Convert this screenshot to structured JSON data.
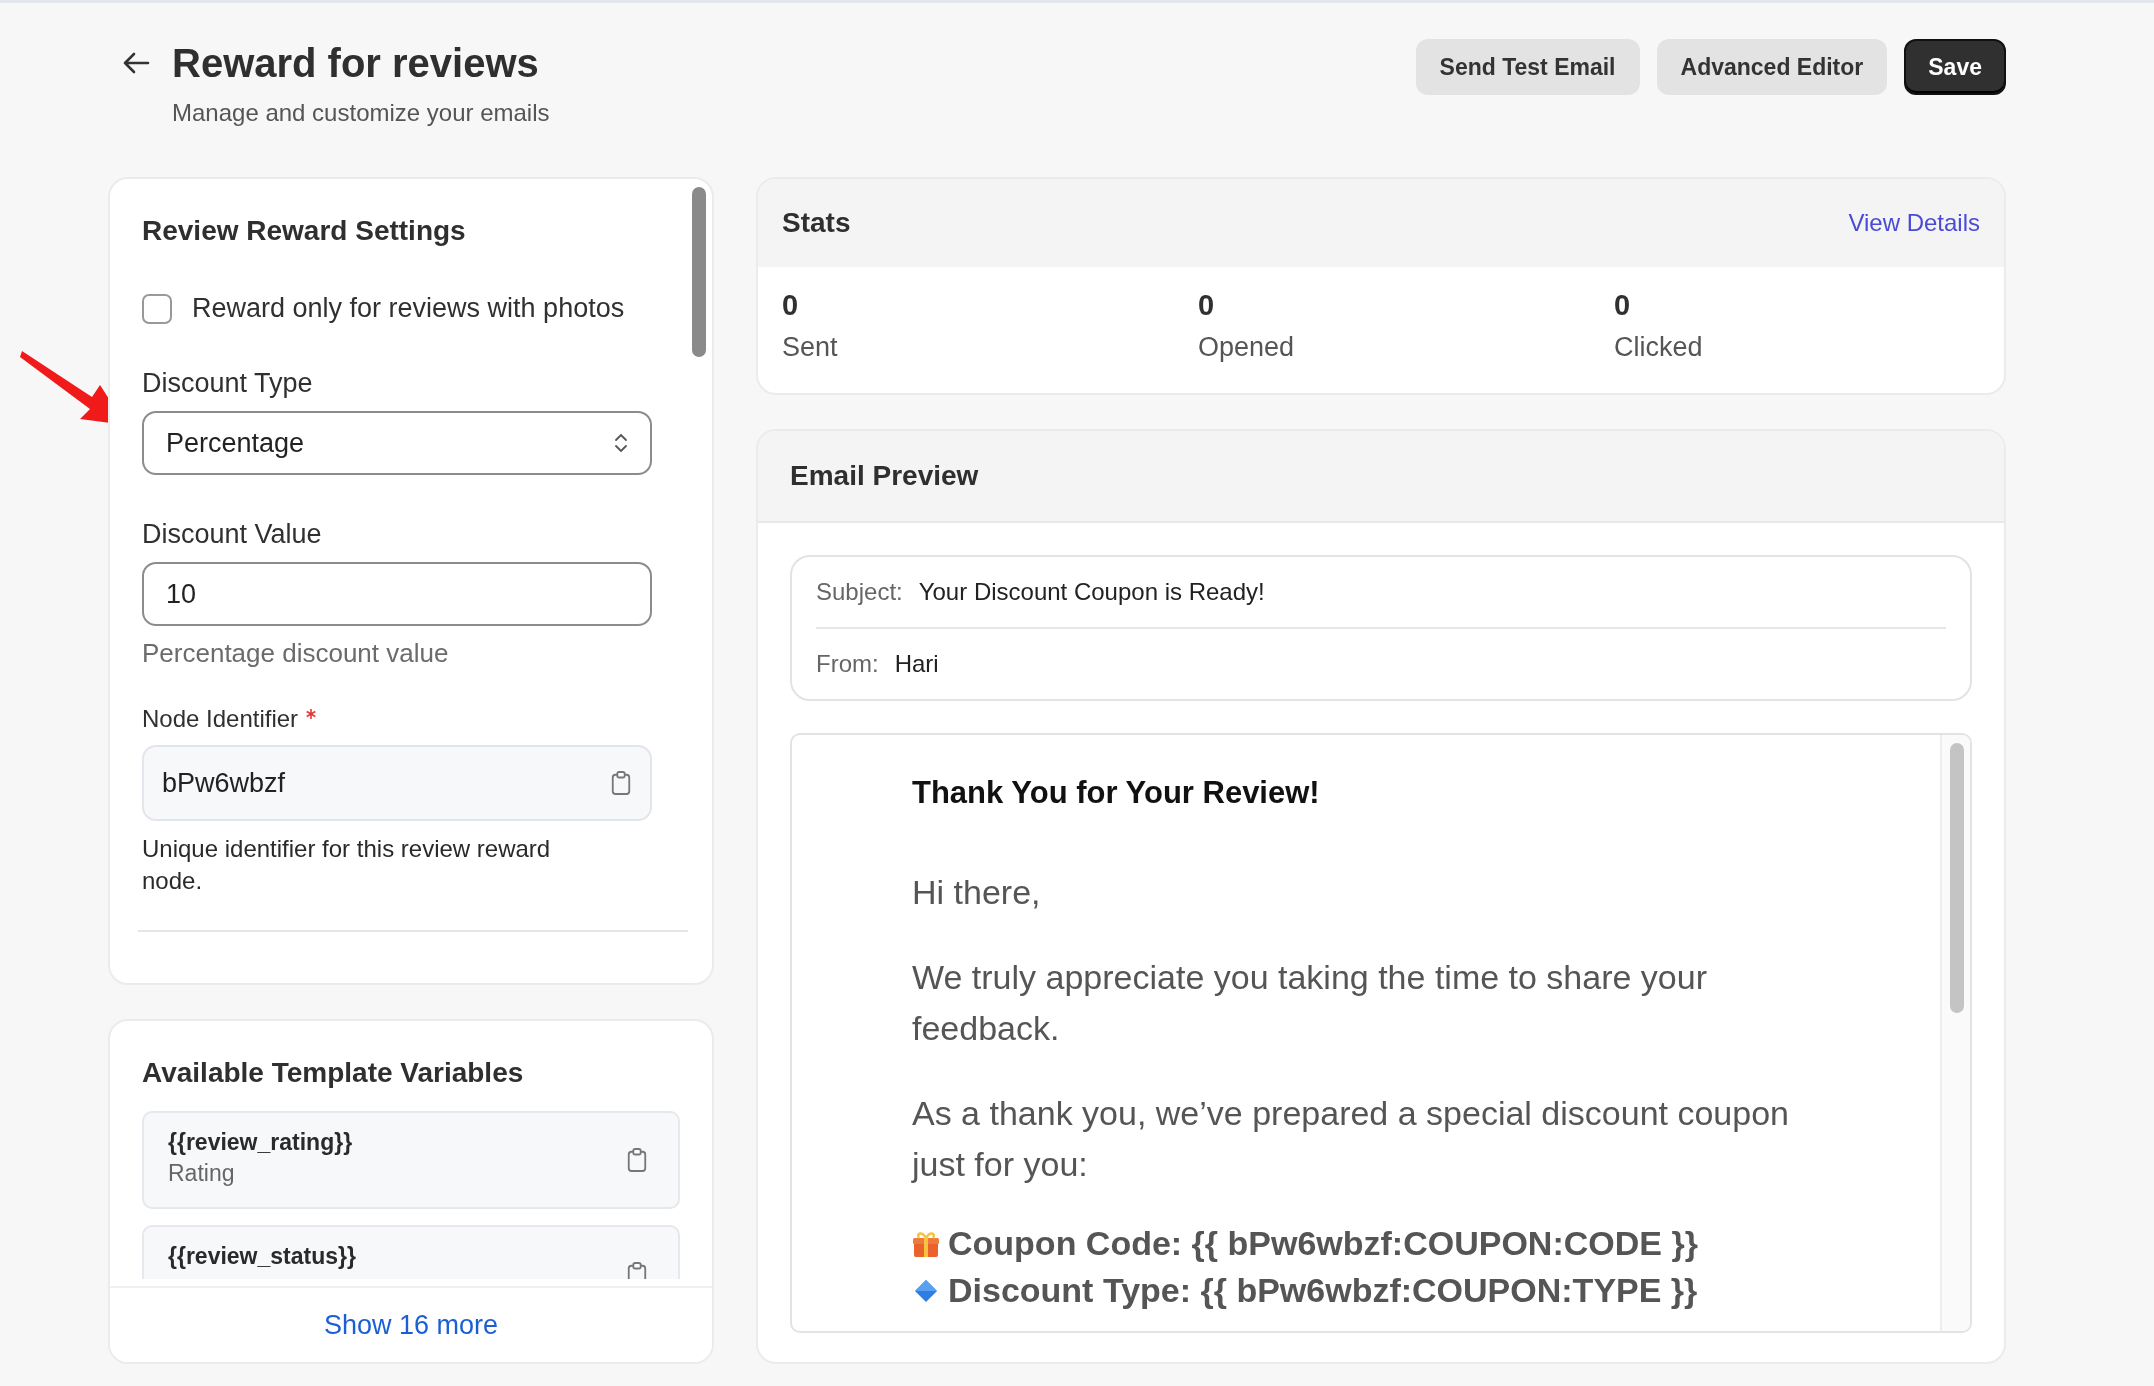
{
  "header": {
    "title": "Reward for reviews",
    "subtitle": "Manage and customize your emails"
  },
  "actions": [
    {
      "label": "Send Test Email",
      "kind": "secondary"
    },
    {
      "label": "Advanced Editor",
      "kind": "secondary"
    },
    {
      "label": "Save",
      "kind": "primary"
    }
  ],
  "settings": {
    "title": "Review Reward Settings",
    "checkbox": {
      "label": "Reward only for reviews with photos",
      "checked": false
    },
    "discount_type": {
      "label": "Discount Type",
      "value": "Percentage"
    },
    "discount_value": {
      "label": "Discount Value",
      "value": "10",
      "hint": "Percentage discount value"
    },
    "node_identifier": {
      "label": "Node Identifier",
      "required": true,
      "value": "bPw6wbzf",
      "hint": "Unique identifier for this review reward node."
    }
  },
  "variables": {
    "title": "Available Template Variables",
    "items": [
      {
        "name": "{{review_rating}}",
        "description": "Rating"
      },
      {
        "name": "{{review_status}}"
      }
    ],
    "show_more": "Show 16 more"
  },
  "stats": {
    "title": "Stats",
    "link": "View Details",
    "metrics": [
      {
        "value": "0",
        "label": "Sent"
      },
      {
        "value": "0",
        "label": "Opened"
      },
      {
        "value": "0",
        "label": "Clicked"
      }
    ]
  },
  "preview": {
    "title": "Email Preview",
    "subject_label": "Subject:",
    "subject": "Your Discount Coupon is Ready!",
    "from_label": "From:",
    "from": "Hari",
    "heading": "Thank You for Your Review!",
    "paragraphs": [
      "Hi there,",
      "We truly appreciate you taking the time to share your feedback.",
      "As a thank you, we’ve prepared a special discount coupon just for you:"
    ],
    "details": [
      {
        "kind": "gift",
        "text": "Coupon Code: {{ bPw6wbzf:COUPON:CODE }}"
      },
      {
        "kind": "diamond",
        "text": "Discount Type: {{ bPw6wbzf:COUPON:TYPE }}"
      }
    ]
  }
}
